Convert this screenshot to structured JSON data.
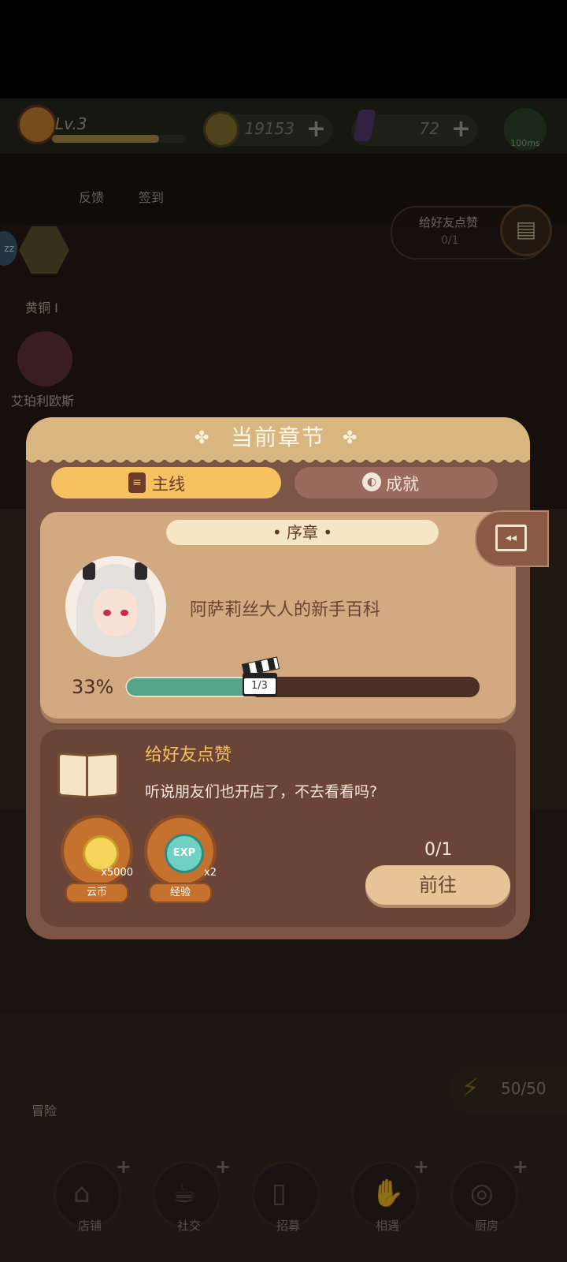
{
  "hud": {
    "level": "Lv.3",
    "xp_progress": 0.8,
    "coins": "19153",
    "gems": "72",
    "ping": "100ms"
  },
  "shortcuts": {
    "feedback": "反馈",
    "checkin": "签到"
  },
  "friend_like_pill": {
    "title": "给好友点赞",
    "count": "0/1"
  },
  "rank": {
    "label": "黄铜 I"
  },
  "employee": {
    "label": "艾珀利欧斯"
  },
  "adventure": {
    "label": "冒险"
  },
  "energy": {
    "value": "50/50"
  },
  "bottom_nav": {
    "shop": "店铺",
    "social": "社交",
    "recruit": "招募",
    "encounter": "相遇",
    "kitchen": "厨房"
  },
  "modal": {
    "title": "当前章节",
    "tabs": {
      "main": "主线",
      "achievement": "成就"
    },
    "chapter": {
      "name": "• 序章 •",
      "subtitle": "阿萨莉丝大人的新手百科",
      "percent_label": "33%",
      "progress": 0.33,
      "step_label": "1/3"
    },
    "task": {
      "title": "给好友点赞",
      "description": "听说朋友们也开店了，不去看看吗?",
      "progress": "0/1",
      "go_label": "前往",
      "rewards": [
        {
          "name": "云币",
          "qty": "x5000",
          "icon": "cloud-coin-icon"
        },
        {
          "name": "经验",
          "qty": "x2",
          "icon": "exp-icon"
        }
      ]
    }
  },
  "colors": {
    "tab_active": "#f6c161",
    "modal_bg": "#7c5546",
    "progress_fill": "#55a58a",
    "accent_text": "#f6c161"
  }
}
